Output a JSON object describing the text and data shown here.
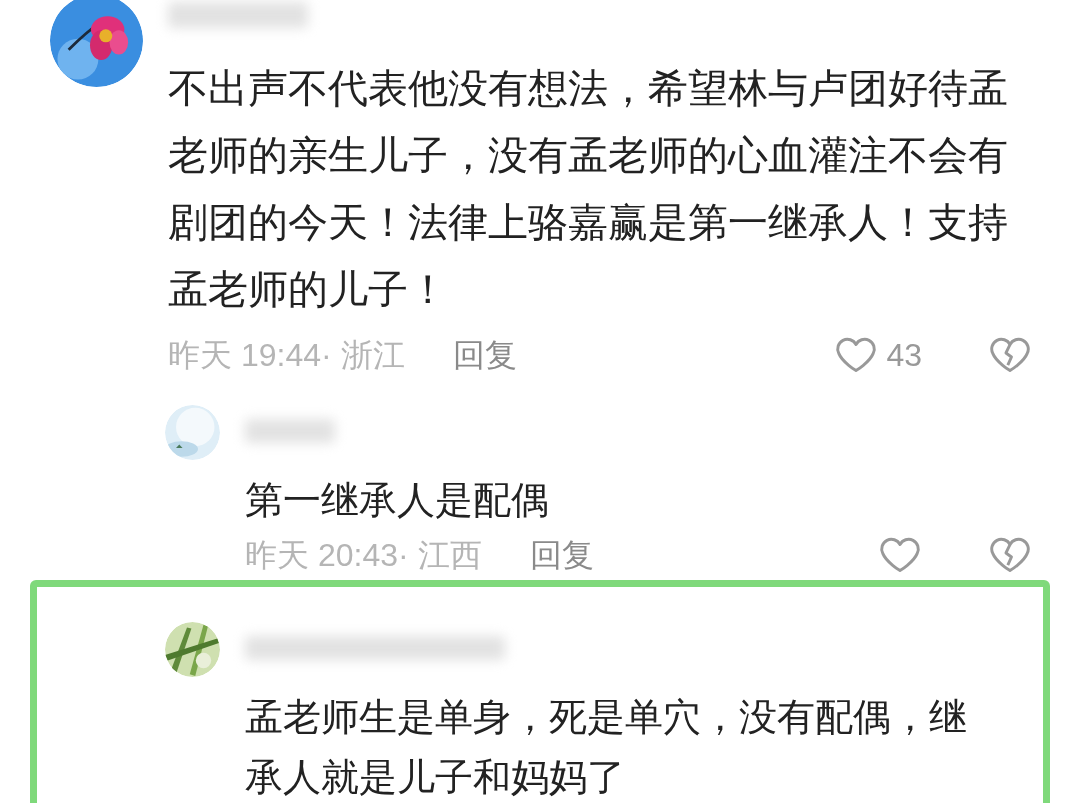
{
  "comments": [
    {
      "text": "不出声不代表他没有想法，希望林与卢团好待孟老师的亲生儿子，没有孟老师的心血灌注不会有剧团的今天！法律上骆嘉赢是第一继承人！支持孟老师的儿子！",
      "meta": "昨天 19:44· 浙江",
      "reply_label": "回复",
      "like_count": "43",
      "replies": [
        {
          "text": "第一继承人是配偶",
          "meta": "昨天 20:43· 江西",
          "reply_label": "回复",
          "highlighted": false
        },
        {
          "text": "孟老师生是单身，死是单穴，没有配偶，继承人就是儿子和妈妈了",
          "highlighted": true
        }
      ]
    }
  ]
}
